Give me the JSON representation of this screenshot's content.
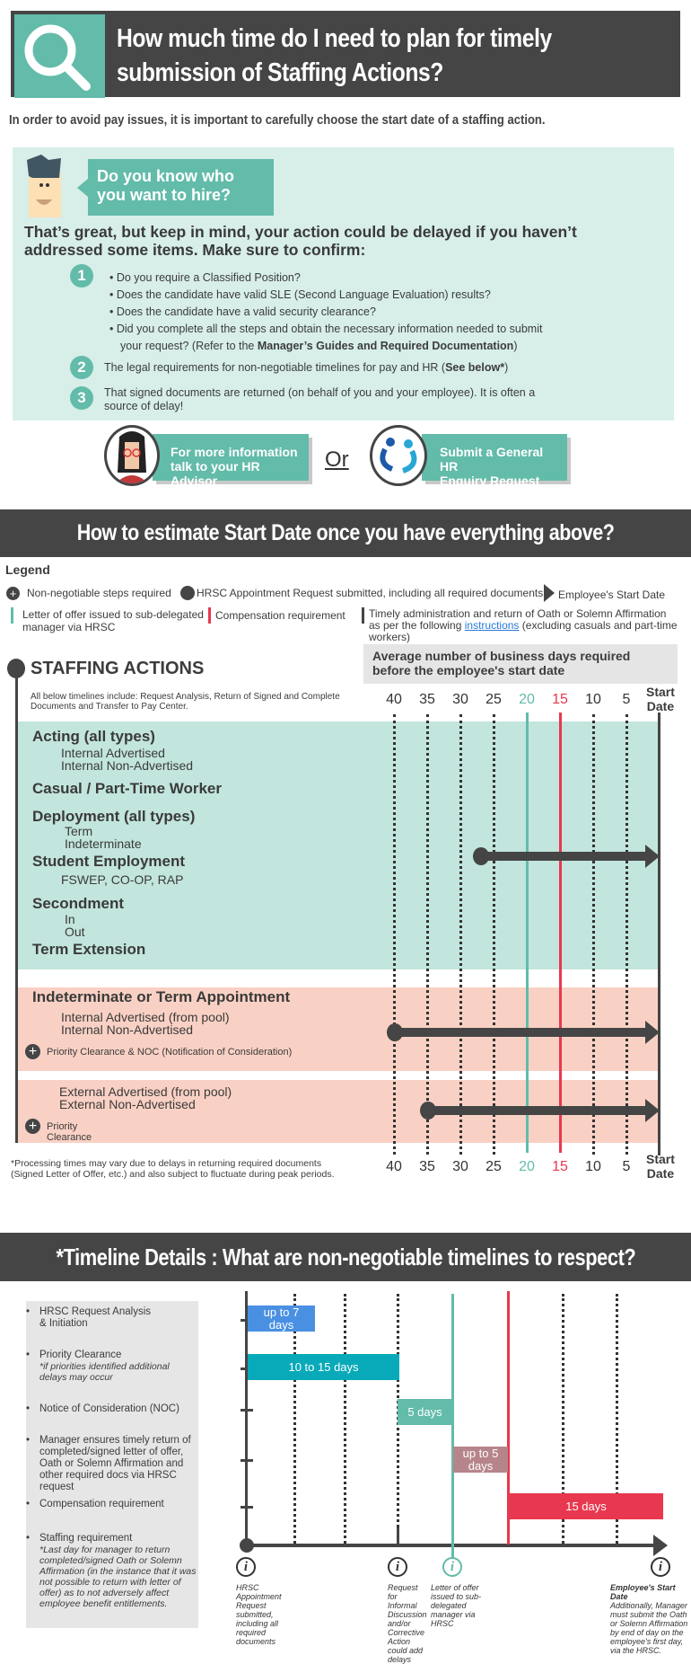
{
  "header": {
    "title_line1": "How much time do I need to plan for timely",
    "title_line2": "submission of Staffing Actions?",
    "icon": "magnifier-icon"
  },
  "intro": "In order to avoid pay issues, it is important to carefully choose the start date of a staffing action.",
  "checklist": {
    "bubble_line1": "Do you know who",
    "bubble_line2": "you want to hire?",
    "heading_line1": "That’s great, but keep in mind, your action could be delayed if you haven’t",
    "heading_line2": "addressed some items. Make sure to confirm:",
    "item1_number": "1",
    "item1_bullets": [
      "Do you require a Classified Position?",
      "Does the candidate have valid SLE (Second Language Evaluation) results?",
      "Does the candidate have a valid security clearance?",
      "Did you complete all the steps and obtain the necessary information needed to submit"
    ],
    "item1_cont_prefix": "your request? (Refer to the ",
    "item1_cont_bold": "Manager’s Guides and Required Documentation",
    "item1_cont_suffix": ")",
    "item2_number": "2",
    "item2_text": "The legal requirements for non-negotiable timelines for pay and HR (",
    "item2_bold": "See below*",
    "item2_suffix": ")",
    "item3_number": "3",
    "item3_line1": "That signed documents are returned (on behalf of you and your employee). It is often a",
    "item3_line2": "source of delay!"
  },
  "contacts": {
    "advisor_line1": "For more information",
    "advisor_line2": "talk to your HR Advisor",
    "or": "Or",
    "enquiry_line1": "Submit a General HR",
    "enquiry_line2": "Enquiry Request"
  },
  "estimate": {
    "title": "How to estimate Start Date once you have everything above?",
    "legend_title": "Legend",
    "legend": {
      "plus": "Non-negotiable steps required",
      "circle": "HRSC Appointment Request submitted, including all required documents",
      "triangle": "Employee's Start Date",
      "teal_line_1": "Letter of offer issued to sub-delegated",
      "teal_line_2": "manager via HRSC",
      "red_line": "Compensation requirement",
      "dark_line_1": "Timely administration and return of Oath or Solemn Affirmation",
      "dark_line_2_prefix": "as per the following ",
      "dark_line_2_link": "instructions",
      "dark_line_2_suffix": " (excluding casuals and part-time",
      "dark_line_3": "workers)"
    },
    "staffing_title": "STAFFING ACTIONS",
    "avg_box_line1": "Average number of business days required",
    "avg_box_line2": "before the employee's start date",
    "note_line1": "All below timelines include: Request Analysis, Return of Signed and Complete",
    "note_line2": "Documents and Transfer to Pay Center.",
    "axis_ticks": [
      "40",
      "35",
      "30",
      "25",
      "20",
      "15",
      "10",
      "5"
    ],
    "axis_start_1": "Start",
    "axis_start_2": "Date",
    "teal_marker_day": 20,
    "red_marker_day": 15,
    "colors": {
      "teal": "#63bbaa",
      "red": "#e8384f",
      "dark": "#454545",
      "band_teal": "#c2e5dd",
      "band_pink": "#f9d1c4"
    },
    "group1": {
      "acting": "Acting (all types)",
      "acting_items": [
        "Internal Advertised",
        "Internal Non-Advertised"
      ],
      "casual": "Casual / Part-Time Worker",
      "deployment": "Deployment (all types)",
      "deployment_items": [
        "Term",
        "Indeterminate"
      ],
      "student": "Student Employment",
      "student_items": [
        "FSWEP, CO-OP, RAP"
      ],
      "secondment": "Secondment",
      "secondment_items": [
        "In",
        "Out"
      ],
      "term_ext": "Term Extension",
      "arrow_start_days": 27
    },
    "group2": {
      "title": "Indeterminate or Term Appointment",
      "items": [
        "Internal Advertised (from pool)",
        "Internal Non-Advertised"
      ],
      "plus_note": "Priority Clearance & NOC (Notification of Consideration)",
      "arrow_start_days": 40
    },
    "group3": {
      "items": [
        "External Advertised (from pool)",
        "External Non-Advertised"
      ],
      "plus_note": "Priority Clearance",
      "arrow_start_days": 35
    },
    "footnote_line1": "*Processing times may vary due to delays in returning required documents",
    "footnote_line2": "(Signed Letter of Offer, etc.) and also subject to fluctuate during peak periods."
  },
  "details": {
    "title": "*Timeline Details : What are non-negotiable timelines to respect?",
    "steps": [
      {
        "label": "HRSC Request Analysis",
        "label2": "& Initiation",
        "note": ""
      },
      {
        "label": "Priority Clearance",
        "label2": "",
        "note": "*if priorities identified additional delays may occur"
      },
      {
        "label": "Notice of Consideration (NOC)",
        "label2": "",
        "note": ""
      },
      {
        "label": "Manager ensures timely return of completed/signed letter of offer, Oath or Solemn Affirmation and other required docs via HRSC request",
        "label2": "",
        "note": ""
      },
      {
        "label": "Compensation requirement",
        "label2": "",
        "note": ""
      },
      {
        "label": "Staffing requirement",
        "label2": "",
        "note": "*Last day for manager to return completed/signed Oath or Solemn Affirmation (in the instance that it was not possible to return with letter of offer) as to not adversely affect employee benefit entitlements."
      }
    ],
    "bars": [
      {
        "label": "up to 7 days",
        "color": "#4a90e2"
      },
      {
        "label": "10 to 15 days",
        "color": "#08aab9"
      },
      {
        "label": "5 days",
        "color": "#63bbaa"
      },
      {
        "label": "up to 5 days",
        "color": "#b5858b"
      },
      {
        "label": "15 days",
        "color": "#e8384f"
      }
    ],
    "captions": [
      {
        "text": "HRSC Appointment Request submitted, including all required documents"
      },
      {
        "text": "Request for Informal Discussion and/or Corrective Action could add delays"
      },
      {
        "text": "Letter of offer issued to sub-delegated manager via HRSC"
      },
      {
        "title": "Employee's Start Date",
        "text": "Additionally, Manager must submit the Oath or Solemn Affirmation by end of day on the employee's first day, via the HRSC."
      }
    ]
  }
}
